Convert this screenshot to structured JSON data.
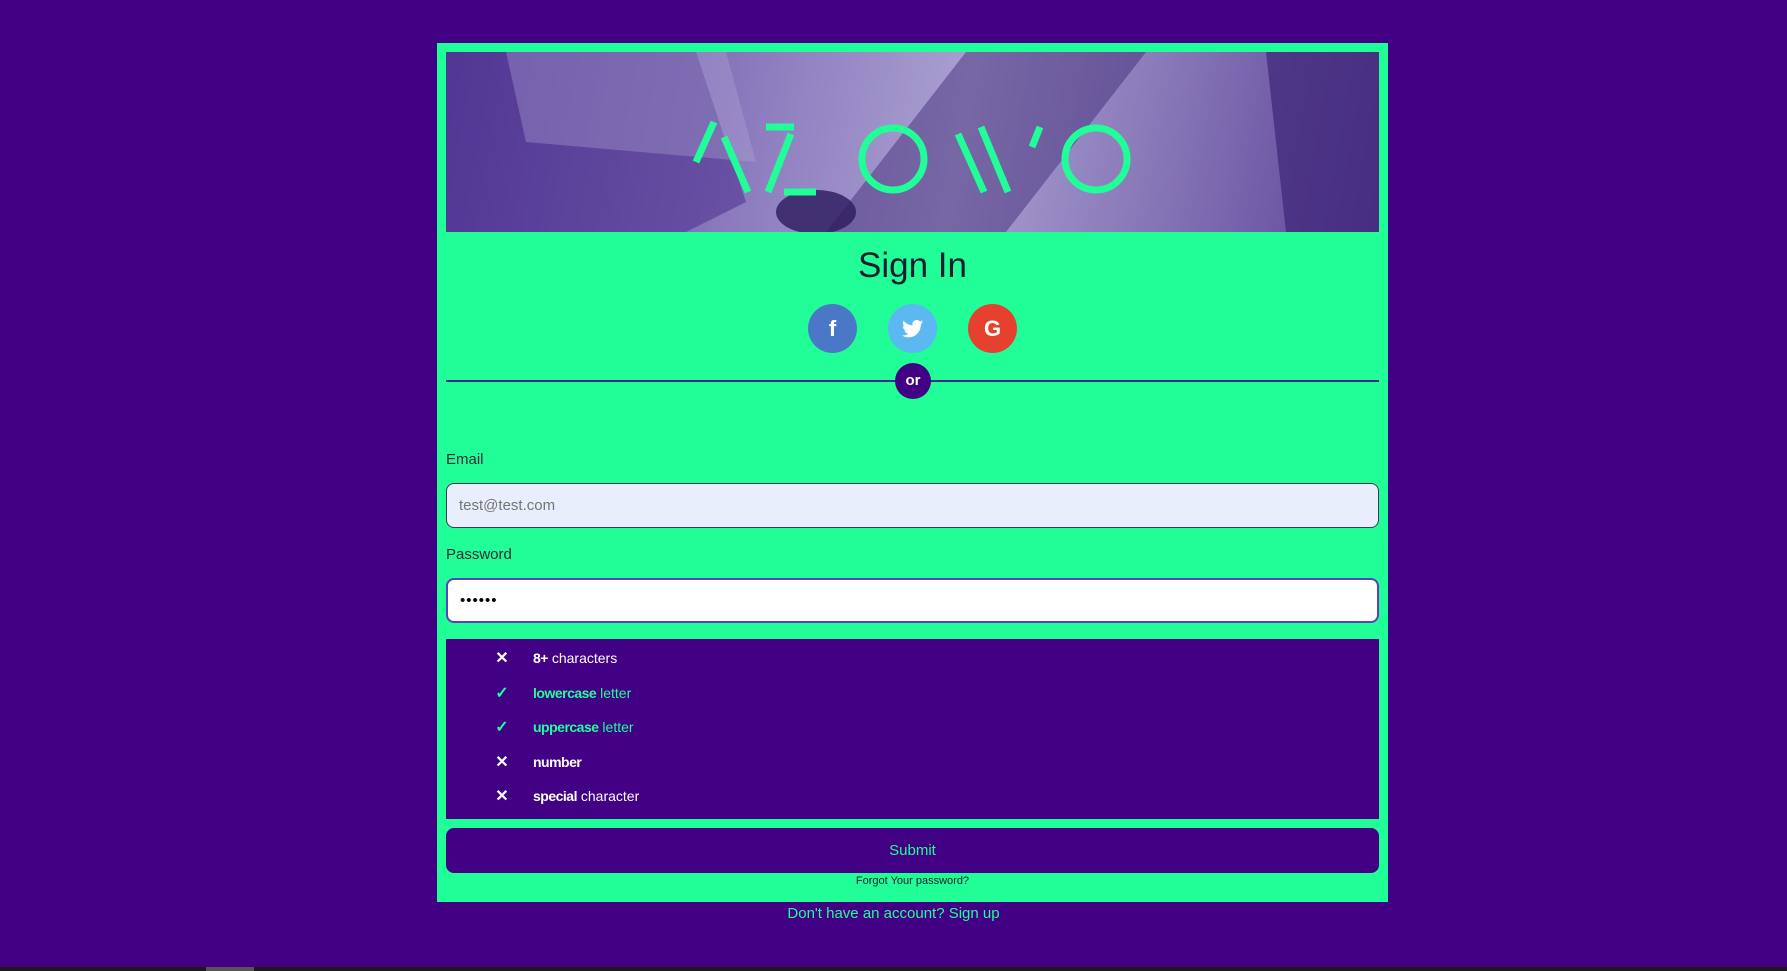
{
  "page_title": "Sign In",
  "social": {
    "facebook_glyph": "f",
    "twitter_icon": "twitter-bird-icon",
    "google_glyph": "G"
  },
  "divider_text": "or",
  "email": {
    "label": "Email",
    "placeholder": "test@test.com"
  },
  "password": {
    "label": "Password",
    "value": "••••••"
  },
  "requirements": [
    {
      "status": "fail",
      "mark": "✕",
      "bold": "8+",
      "rest": " characters"
    },
    {
      "status": "pass",
      "mark": "✓",
      "bold": "lowercase",
      "rest": " letter"
    },
    {
      "status": "pass",
      "mark": "✓",
      "bold": "uppercase",
      "rest": " letter"
    },
    {
      "status": "fail",
      "mark": "✕",
      "bold": "number",
      "rest": ""
    },
    {
      "status": "fail",
      "mark": "✕",
      "bold": "special",
      "rest": " character"
    }
  ],
  "submit_label": "Submit",
  "forgot_link": "Forgot Your password?",
  "signup_link": "Don't have an account? Sign up",
  "colors": {
    "background": "#420084",
    "accent": "#21fd97"
  }
}
